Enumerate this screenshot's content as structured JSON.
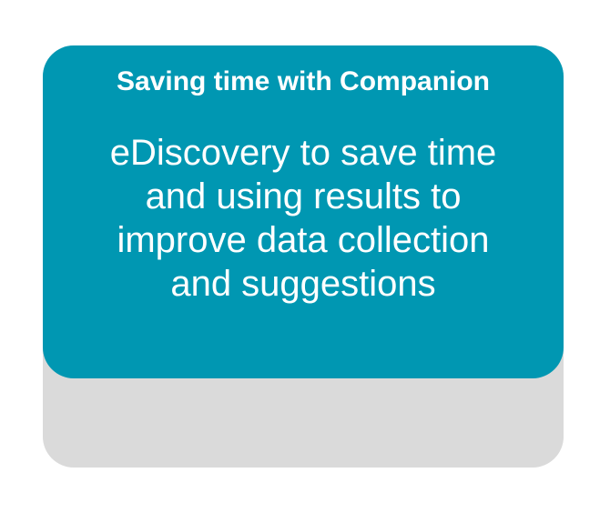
{
  "card": {
    "title": "Saving time with Companion",
    "body_lines": [
      "eDiscovery to save time",
      "and using results to",
      "improve data collection",
      "and suggestions"
    ]
  },
  "colors": {
    "front_card": "#0097b2",
    "back_card": "#dadada",
    "text": "#ffffff"
  }
}
